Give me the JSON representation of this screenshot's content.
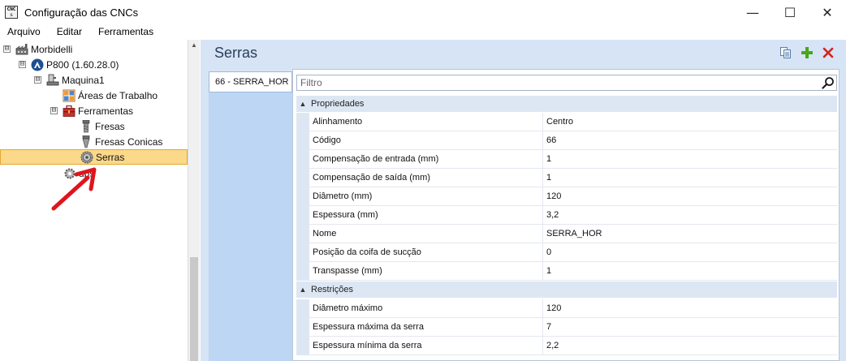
{
  "window": {
    "title": "Configuração das CNCs",
    "app_icon_text_top": "CNC",
    "app_icon_text_bottom": "s",
    "minimize_glyph": "—",
    "maximize_glyph": "☐",
    "close_glyph": "✕"
  },
  "menu": {
    "items": [
      "Arquivo",
      "Editar",
      "Ferramentas"
    ]
  },
  "tree": {
    "nodes": [
      {
        "label": "Morbidelli",
        "expander": "⊟",
        "icon": "factory-icon"
      },
      {
        "label": "P800 (1.60.28.0)",
        "expander": "⊟",
        "icon": "machine-logo-icon"
      },
      {
        "label": "Maquina1",
        "expander": "⊟",
        "icon": "machine-icon"
      },
      {
        "label": "Áreas de Trabalho",
        "icon": "work-areas-icon"
      },
      {
        "label": "Ferramentas",
        "expander": "⊟",
        "icon": "toolbox-icon"
      },
      {
        "label": "Fresas",
        "icon": "mill-tool-icon"
      },
      {
        "label": "Fresas Conicas",
        "icon": "conical-mill-icon"
      },
      {
        "label": "Serras",
        "icon": "saw-blade-icon",
        "selected": true
      },
      {
        "label": "ups",
        "icon": "setups-gear-icon"
      }
    ]
  },
  "main": {
    "title": "Serras",
    "toolbar": {
      "icons": [
        "copy-icon",
        "add-icon",
        "delete-icon"
      ]
    },
    "list": {
      "items": [
        "66 - SERRA_HOR"
      ]
    },
    "filter": {
      "placeholder": "Filtro"
    },
    "categories": [
      {
        "label": "Propriedades",
        "arrow": "▲",
        "rows": [
          {
            "name": "Alinhamento",
            "value": "Centro"
          },
          {
            "name": "Código",
            "value": "66"
          },
          {
            "name": "Compensação de entrada (mm)",
            "value": "1"
          },
          {
            "name": "Compensação de saída (mm)",
            "value": "1"
          },
          {
            "name": "Diâmetro (mm)",
            "value": "120"
          },
          {
            "name": "Espessura (mm)",
            "value": "3,2"
          },
          {
            "name": "Nome",
            "value": "SERRA_HOR"
          },
          {
            "name": "Posição da coifa de sucção",
            "value": "0"
          },
          {
            "name": "Transpasse (mm)",
            "value": "1"
          }
        ]
      },
      {
        "label": "Restrições",
        "arrow": "▲",
        "rows": [
          {
            "name": "Diâmetro máximo",
            "value": "120"
          },
          {
            "name": "Espessura máxima da serra",
            "value": "7"
          },
          {
            "name": "Espessura mínima da serra",
            "value": "2,2"
          }
        ]
      }
    ]
  },
  "colors": {
    "selection_bg": "#fbd88a",
    "panel_bg": "#d6e4f5",
    "category_bg": "#dde7f4",
    "annotation_arrow": "#e0141e",
    "add_icon": "#49a61c",
    "delete_icon": "#d9231c"
  }
}
